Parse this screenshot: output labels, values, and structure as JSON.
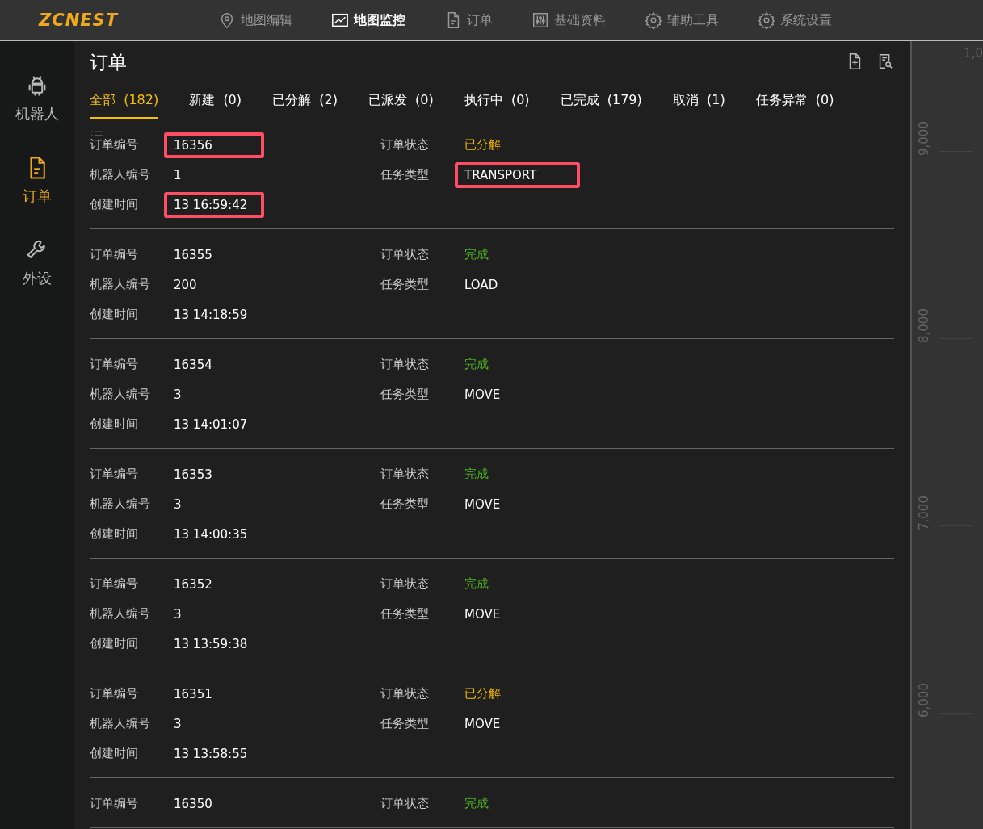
{
  "header": {
    "logo": "ZCNEST",
    "nav": [
      {
        "label": "地图编辑",
        "kind": "pin",
        "selected": false
      },
      {
        "label": "地图监控",
        "kind": "chart",
        "selected": true
      },
      {
        "label": "订单",
        "kind": "doc",
        "selected": false
      },
      {
        "label": "基础资料",
        "kind": "sliders",
        "selected": false
      },
      {
        "label": "辅助工具",
        "kind": "gear",
        "selected": false
      },
      {
        "label": "系统设置",
        "kind": "gear",
        "selected": false
      }
    ]
  },
  "sidebar": {
    "items": [
      {
        "label": "机器人",
        "kind": "robot",
        "selected": false
      },
      {
        "label": "订单",
        "kind": "doc",
        "selected": true
      },
      {
        "label": "外设",
        "kind": "wrench",
        "selected": false
      }
    ]
  },
  "panel": {
    "title": "订单",
    "tabs": [
      {
        "label": "全部",
        "count": "(182)",
        "selected": true
      },
      {
        "label": "新建",
        "count": "(0)",
        "selected": false
      },
      {
        "label": "已分解",
        "count": "(2)",
        "selected": false
      },
      {
        "label": "已派发",
        "count": "(0)",
        "selected": false
      },
      {
        "label": "执行中",
        "count": "(0)",
        "selected": false
      },
      {
        "label": "已完成",
        "count": "(179)",
        "selected": false
      },
      {
        "label": "取消",
        "count": "(1)",
        "selected": false
      },
      {
        "label": "任务异常",
        "count": "(0)",
        "selected": false
      }
    ],
    "orders": [
      {
        "left": [
          {
            "label": "订单编号",
            "value": "16356",
            "highlighted": true
          },
          {
            "label": "机器人编号",
            "value": "1",
            "highlighted": false
          },
          {
            "label": "创建时间",
            "value": "13 16:59:42",
            "highlighted": true
          }
        ],
        "right": [
          {
            "label": "订单状态",
            "value": "已分解",
            "color": "#f5b800",
            "highlighted": false
          },
          {
            "label": "任务类型",
            "value": "TRANSPORT",
            "color": "#ffffff",
            "highlighted": true
          }
        ]
      },
      {
        "left": [
          {
            "label": "订单编号",
            "value": "16355",
            "highlighted": false
          },
          {
            "label": "机器人编号",
            "value": "200",
            "highlighted": false
          },
          {
            "label": "创建时间",
            "value": "13 14:18:59",
            "highlighted": false
          }
        ],
        "right": [
          {
            "label": "订单状态",
            "value": "完成",
            "color": "#4caf22",
            "highlighted": false
          },
          {
            "label": "任务类型",
            "value": "LOAD",
            "color": "#ffffff",
            "highlighted": false
          }
        ]
      },
      {
        "left": [
          {
            "label": "订单编号",
            "value": "16354",
            "highlighted": false
          },
          {
            "label": "机器人编号",
            "value": "3",
            "highlighted": false
          },
          {
            "label": "创建时间",
            "value": "13 14:01:07",
            "highlighted": false
          }
        ],
        "right": [
          {
            "label": "订单状态",
            "value": "完成",
            "color": "#4caf22",
            "highlighted": false
          },
          {
            "label": "任务类型",
            "value": "MOVE",
            "color": "#ffffff",
            "highlighted": false
          }
        ]
      },
      {
        "left": [
          {
            "label": "订单编号",
            "value": "16353",
            "highlighted": false
          },
          {
            "label": "机器人编号",
            "value": "3",
            "highlighted": false
          },
          {
            "label": "创建时间",
            "value": "13 14:00:35",
            "highlighted": false
          }
        ],
        "right": [
          {
            "label": "订单状态",
            "value": "完成",
            "color": "#4caf22",
            "highlighted": false
          },
          {
            "label": "任务类型",
            "value": "MOVE",
            "color": "#ffffff",
            "highlighted": false
          }
        ]
      },
      {
        "left": [
          {
            "label": "订单编号",
            "value": "16352",
            "highlighted": false
          },
          {
            "label": "机器人编号",
            "value": "3",
            "highlighted": false
          },
          {
            "label": "创建时间",
            "value": "13 13:59:38",
            "highlighted": false
          }
        ],
        "right": [
          {
            "label": "订单状态",
            "value": "完成",
            "color": "#4caf22",
            "highlighted": false
          },
          {
            "label": "任务类型",
            "value": "MOVE",
            "color": "#ffffff",
            "highlighted": false
          }
        ]
      },
      {
        "left": [
          {
            "label": "订单编号",
            "value": "16351",
            "highlighted": false
          },
          {
            "label": "机器人编号",
            "value": "3",
            "highlighted": false
          },
          {
            "label": "创建时间",
            "value": "13 13:58:55",
            "highlighted": false
          }
        ],
        "right": [
          {
            "label": "订单状态",
            "value": "已分解",
            "color": "#f5b800",
            "highlighted": false
          },
          {
            "label": "任务类型",
            "value": "MOVE",
            "color": "#ffffff",
            "highlighted": false
          }
        ]
      },
      {
        "left": [
          {
            "label": "订单编号",
            "value": "16350",
            "highlighted": false
          }
        ],
        "right": [
          {
            "label": "订单状态",
            "value": "完成",
            "color": "#4caf22",
            "highlighted": false
          }
        ]
      }
    ]
  },
  "ruler": {
    "labels": [
      "1,0",
      "9,000",
      "8,000",
      "7,000",
      "6,000"
    ]
  }
}
